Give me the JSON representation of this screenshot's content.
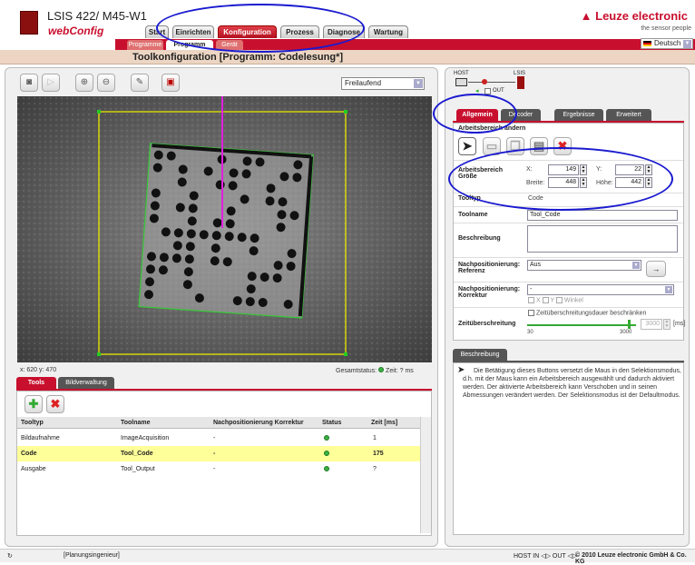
{
  "header": {
    "product_title": "LSIS 422/ M45-W1",
    "app_name": "webConfig",
    "brand": "Leuze electronic",
    "tagline": "the sensor people",
    "language": "Deutsch",
    "tabs": [
      {
        "label": "Start"
      },
      {
        "label": "Einrichten"
      },
      {
        "label": "Konfiguration"
      },
      {
        "label": "Prozess"
      },
      {
        "label": "Diagnose"
      },
      {
        "label": "Wartung"
      }
    ],
    "subtabs": [
      {
        "label": "Programme"
      },
      {
        "label": "Programm"
      },
      {
        "label": "Gerät"
      }
    ]
  },
  "title_bar": {
    "text": "Toolkonfiguration   [Programm: Codelesung*]"
  },
  "toolbar": {
    "mode_value": "Freilaufend",
    "icons": [
      "camera-icon",
      "play-icon",
      "zoom-in-icon",
      "zoom-out-icon",
      "wrench-icon",
      "device-save-icon"
    ]
  },
  "image": {
    "coordinates": "x: 620 y: 470",
    "status_label": "Gesamtstatus:",
    "status_time": "Zeit: ? ms"
  },
  "tools_tabs": [
    {
      "label": "Tools"
    },
    {
      "label": "Bildverwaltung"
    }
  ],
  "tools_table": {
    "columns": [
      "Tooltyp",
      "Toolname",
      "Nachpositionierung Korrektur",
      "Status",
      "Zeit [ms]"
    ],
    "rows": [
      {
        "type": "Bildaufnahme",
        "name": "ImageAcquisition",
        "korr": "-",
        "time": "1"
      },
      {
        "type": "Code",
        "name": "Tool_Code",
        "korr": "-",
        "time": "175"
      },
      {
        "type": "Ausgabe",
        "name": "Tool_Output",
        "korr": "-",
        "time": "?"
      }
    ]
  },
  "diagram": {
    "host": "HOST",
    "device": "LSIS",
    "out": "OUT"
  },
  "right_tabs": [
    {
      "label": "Allgemein"
    },
    {
      "label": "Decoder"
    },
    {
      "label": "Ergebnisse"
    },
    {
      "label": "Erweitert"
    }
  ],
  "props": {
    "section_title": "Arbeitsbereich ändern",
    "area_label": "Arbeitsbereich Größe",
    "x_label": "X:",
    "x_value": "149",
    "y_label": "Y:",
    "y_value": "22",
    "width_label": "Breite:",
    "width_value": "448",
    "height_label": "Höhe:",
    "height_value": "442",
    "tooltype_label": "Tooltyp",
    "tooltype_value": "Code",
    "toolname_label": "Toolname",
    "toolname_value": "Tool_Code",
    "beschreibung_label": "Beschreibung",
    "nachpos_ref_label": "Nachpositionierung: Referenz",
    "nachpos_ref_value": "Aus",
    "nachpos_korr_label": "Nachpositionierung: Korrektur",
    "nachpos_korr_value": "-",
    "check_x": "X",
    "check_y": "Y",
    "check_winkel": "Winkel",
    "timeout_check_label": "Zeitüberschreitungsdauer beschränken",
    "timeout_label": "Zeitüberschreitung",
    "slider_min": "30",
    "slider_max": "3000",
    "timeout_value": "3000",
    "timeout_unit": "[ms]"
  },
  "description": {
    "tab": "Beschreibung",
    "text": "Die Betätigung dieses Buttons versetzt die Maus in den Selektionsmodus, d.h. mit der Maus kann ein Arbeitsbereich ausgewählt und dadurch aktiviert werden. Der aktivierte Arbeitsbereich kann Verschoben und in seinen Abmessungen verändert werden. Der Selektionsmodus ist der Defaultmodus."
  },
  "footer": {
    "role": "[Planungsingenieur]",
    "io": "HOST IN ◁▷  OUT ◁▷",
    "copyright": "© 2010 Leuze electronic GmbH & Co. KG"
  },
  "colors": {
    "accent": "#c8102e",
    "annotation": "#1a1ad0",
    "highlight_row": "#ffff99"
  }
}
